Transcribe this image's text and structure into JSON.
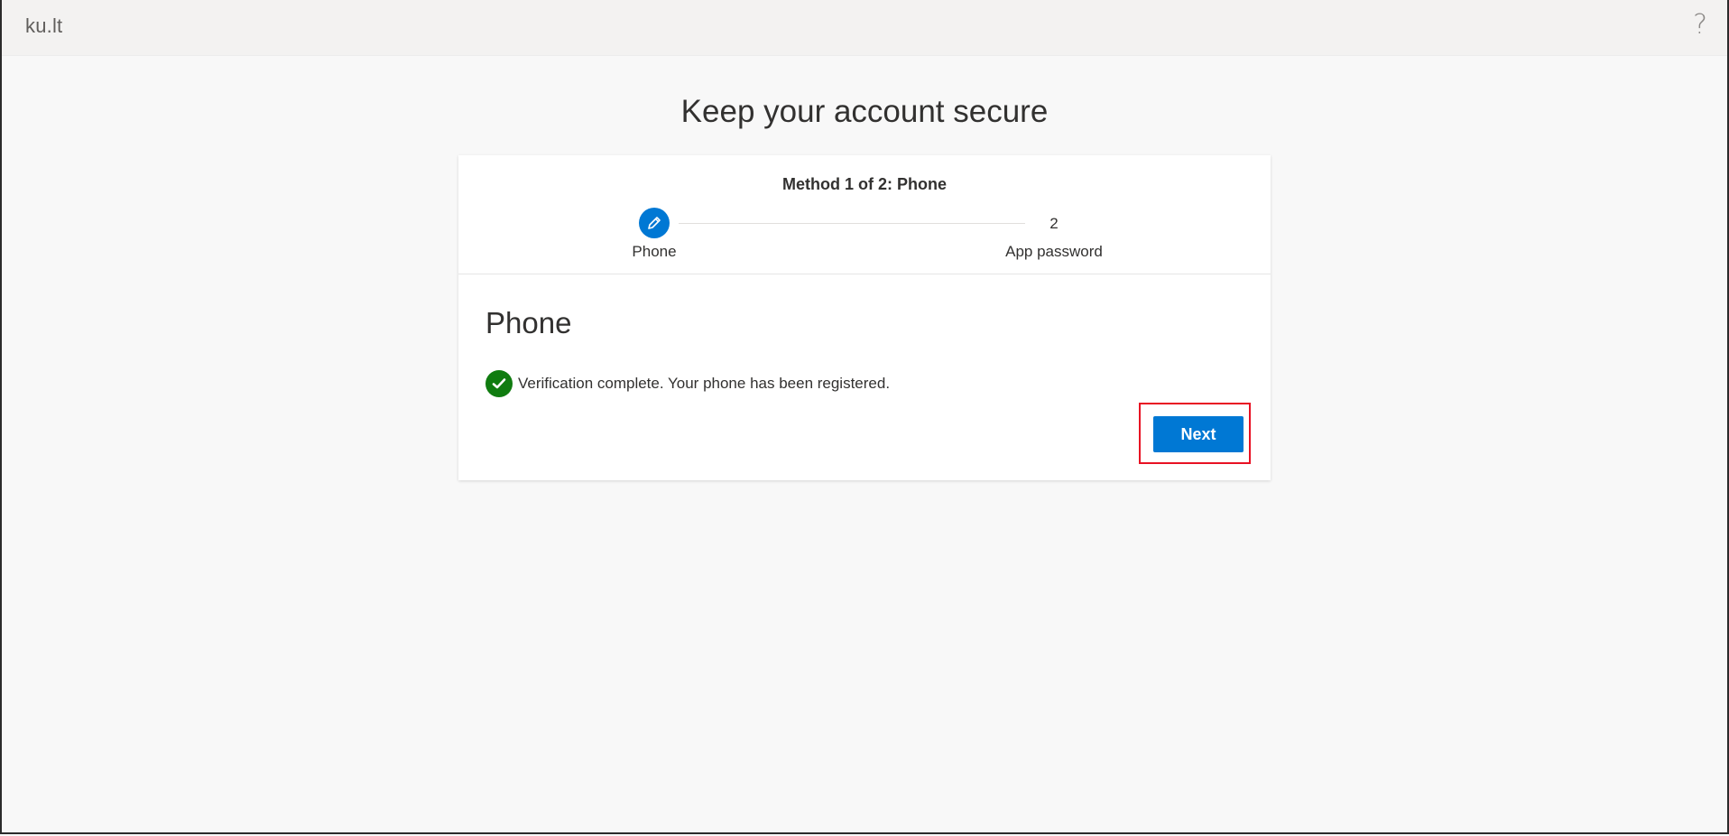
{
  "header": {
    "brand": "ku.lt",
    "help_icon": "question-mark-icon",
    "help_glyph": "?"
  },
  "page": {
    "title": "Keep your account secure"
  },
  "wizard": {
    "method_label": "Method 1 of 2: Phone",
    "steps": [
      {
        "label": "Phone",
        "state": "current",
        "icon": "pencil-icon"
      },
      {
        "number": "2",
        "label": "App password",
        "state": "pending"
      }
    ]
  },
  "section": {
    "title": "Phone",
    "status_icon": "checkmark-circle-icon",
    "status_text": "Verification complete. Your phone has been registered."
  },
  "actions": {
    "next_label": "Next"
  },
  "colors": {
    "accent": "#0078d4",
    "success": "#107c10",
    "highlight": "#e81123"
  }
}
